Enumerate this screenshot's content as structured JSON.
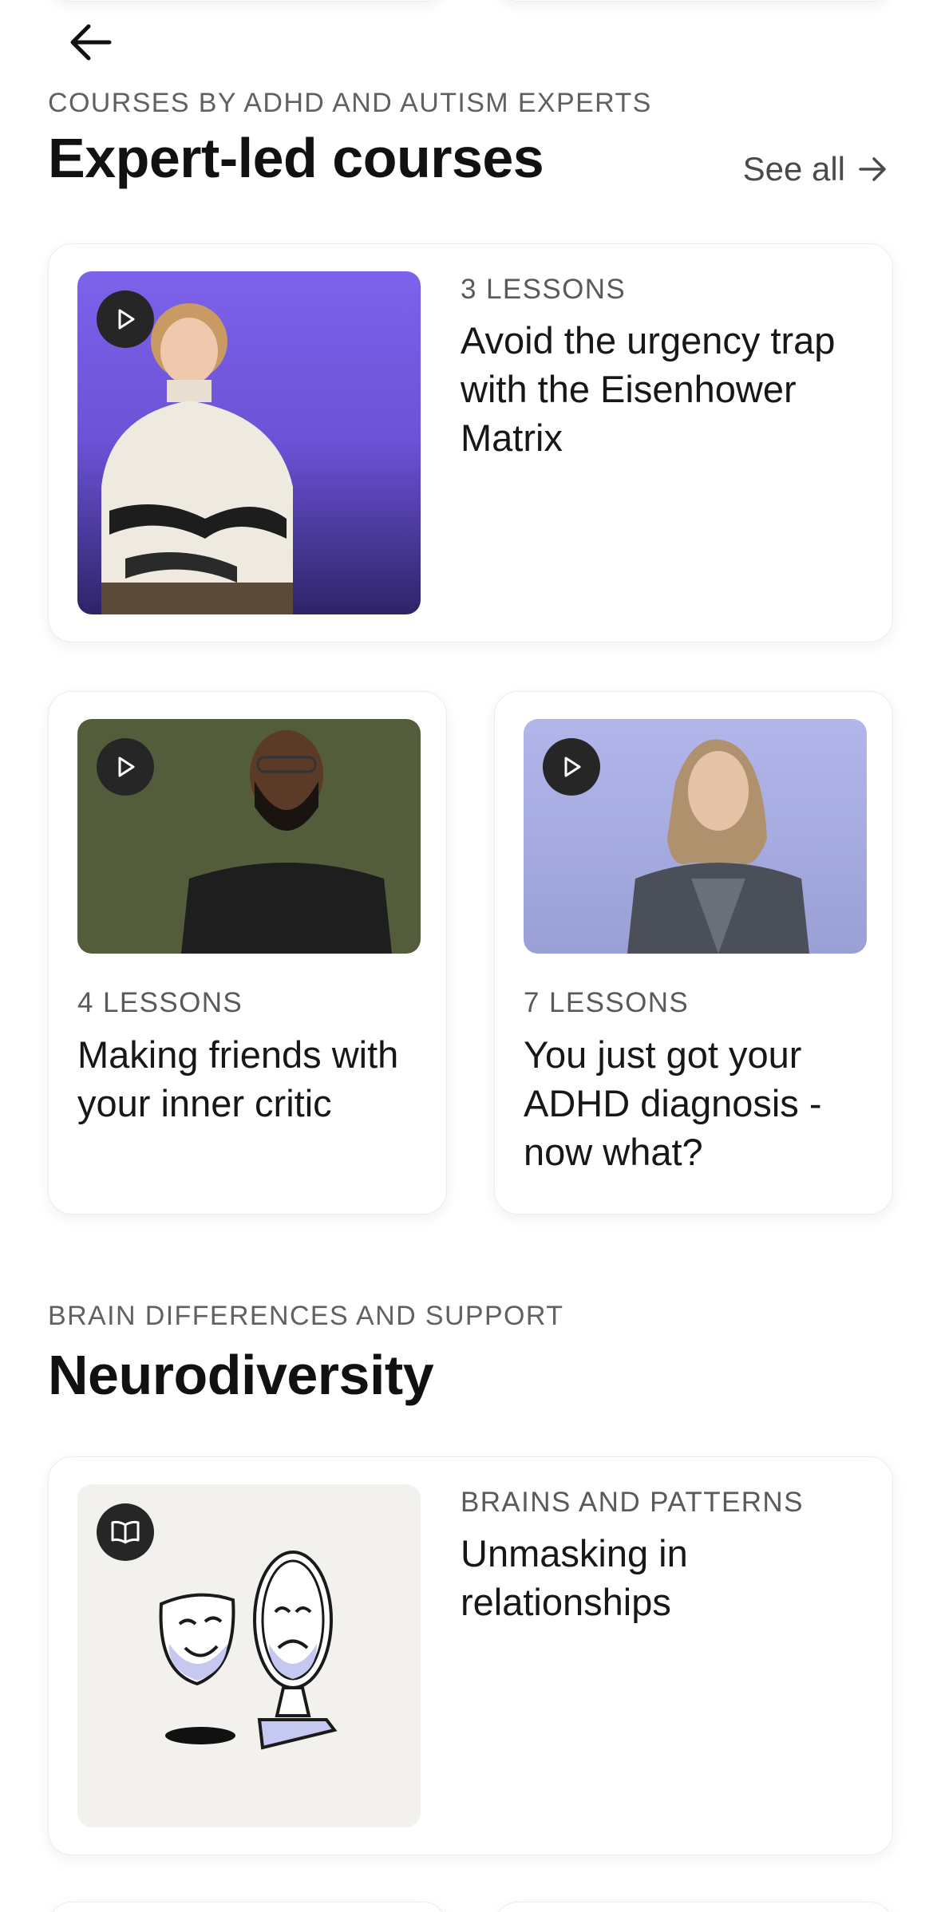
{
  "expert_section": {
    "eyebrow": "COURSES BY ADHD AND AUTISM EXPERTS",
    "title": "Expert-led courses",
    "see_all": "See all",
    "courses": [
      {
        "lessons": "3 LESSONS",
        "title": "Avoid the urgency trap with the Eisenhower Matrix",
        "thumb_bg": "#7a5ce6"
      },
      {
        "lessons": "4 LESSONS",
        "title": "Making friends with your inner critic",
        "thumb_bg": "#535c3b"
      },
      {
        "lessons": "7 LESSONS",
        "title": "You just got your ADHD diagnosis - now what?",
        "thumb_bg": "#a9afe0"
      }
    ]
  },
  "neuro_section": {
    "eyebrow": "BRAIN DIFFERENCES AND SUPPORT",
    "title": "Neurodiversity",
    "articles": [
      {
        "category": "BRAINS AND PATTERNS",
        "title": "Unmasking in relationships",
        "thumb_bg": "#f3f1ee"
      }
    ]
  },
  "icons": {
    "back": "arrow-left-icon",
    "see_all": "arrow-right-icon",
    "video": "play-icon",
    "article": "book-open-icon"
  },
  "colors": {
    "card_border": "#ececec",
    "muted_text": "#5a5a5a",
    "badge_bg": "#262626"
  }
}
